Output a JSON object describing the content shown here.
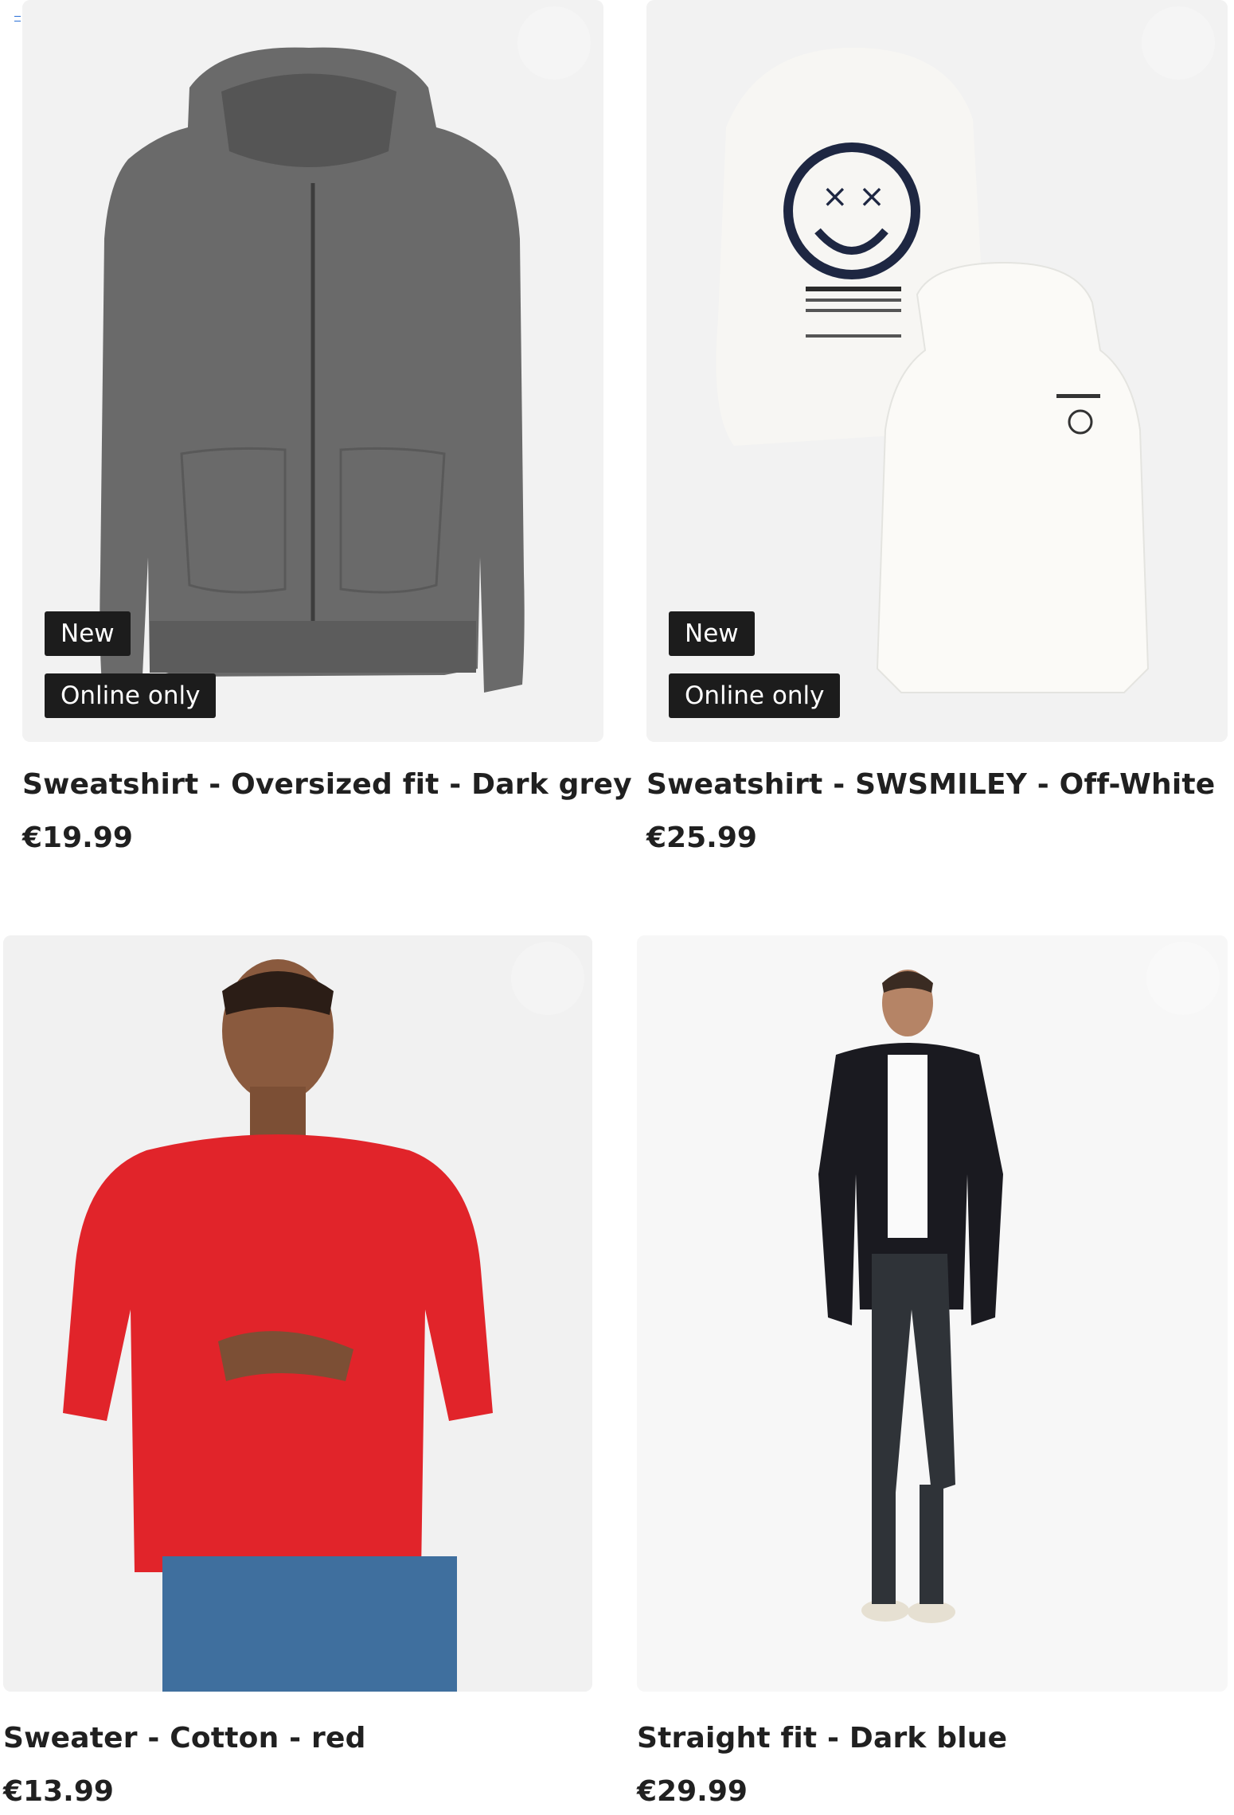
{
  "products": [
    {
      "title": "Sweatshirt - Oversized fit - Dark grey",
      "price": "€19.99",
      "badges": [
        "New",
        "Online only"
      ]
    },
    {
      "title": "Sweatshirt - SWSMILEY - Off-White",
      "price": "€25.99",
      "badges": [
        "New",
        "Online only"
      ]
    },
    {
      "title": "Sweater - Cotton - red",
      "price": "€13.99",
      "badges": []
    },
    {
      "title": "Straight fit - Dark blue",
      "price": "€29.99",
      "badges": []
    }
  ]
}
